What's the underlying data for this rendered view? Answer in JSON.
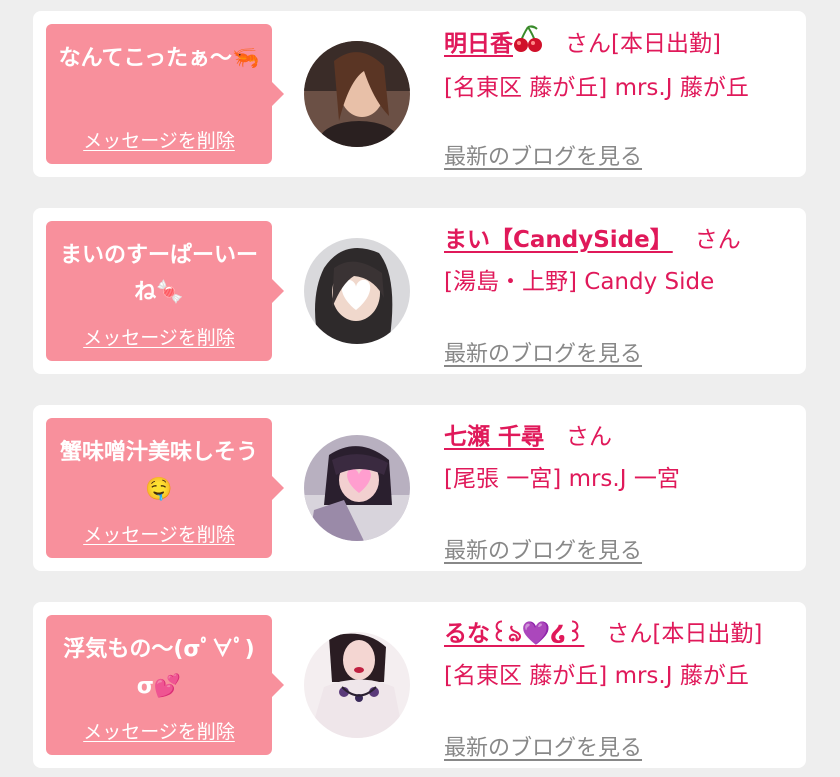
{
  "messages": [
    {
      "message": "なんてこったぁ〜🦐",
      "delete_label": "メッセージを削除",
      "name": "明日香",
      "name_emoji": "cherry",
      "honorific": "さん",
      "status": "[本日出勤]",
      "shop": "[名東区 藤が丘] mrs.J 藤が丘",
      "blog_link": "最新のブログを見る"
    },
    {
      "message": "まいのすーぱーいーね🍬",
      "delete_label": "メッセージを削除",
      "name": "まい【CandySide】",
      "name_emoji": "",
      "honorific": "さん",
      "status": "",
      "shop": "[湯島・上野] Candy Side",
      "blog_link": "最新のブログを見る"
    },
    {
      "message": "蟹味噌汁美味しそう🤤",
      "delete_label": "メッセージを削除",
      "name": "七瀬 千尋",
      "name_emoji": "",
      "honorific": "さん",
      "status": "",
      "shop": "[尾張 一宮] mrs.J 一宮",
      "blog_link": "最新のブログを見る"
    },
    {
      "message": "浮気もの〜(σﾟ∀ﾟ)σ💕",
      "delete_label": "メッセージを削除",
      "name": "るな꒰ঌ💜໒꒱",
      "name_emoji": "",
      "honorific": "さん",
      "status": "[本日出勤]",
      "shop": "[名東区 藤が丘] mrs.J 藤が丘",
      "blog_link": "最新のブログを見る"
    }
  ],
  "colors": {
    "accent": "#e0195a",
    "bubble": "#f8909c",
    "link_gray": "#888888",
    "card": "#ffffff",
    "page_bg": "#eeeeee"
  }
}
